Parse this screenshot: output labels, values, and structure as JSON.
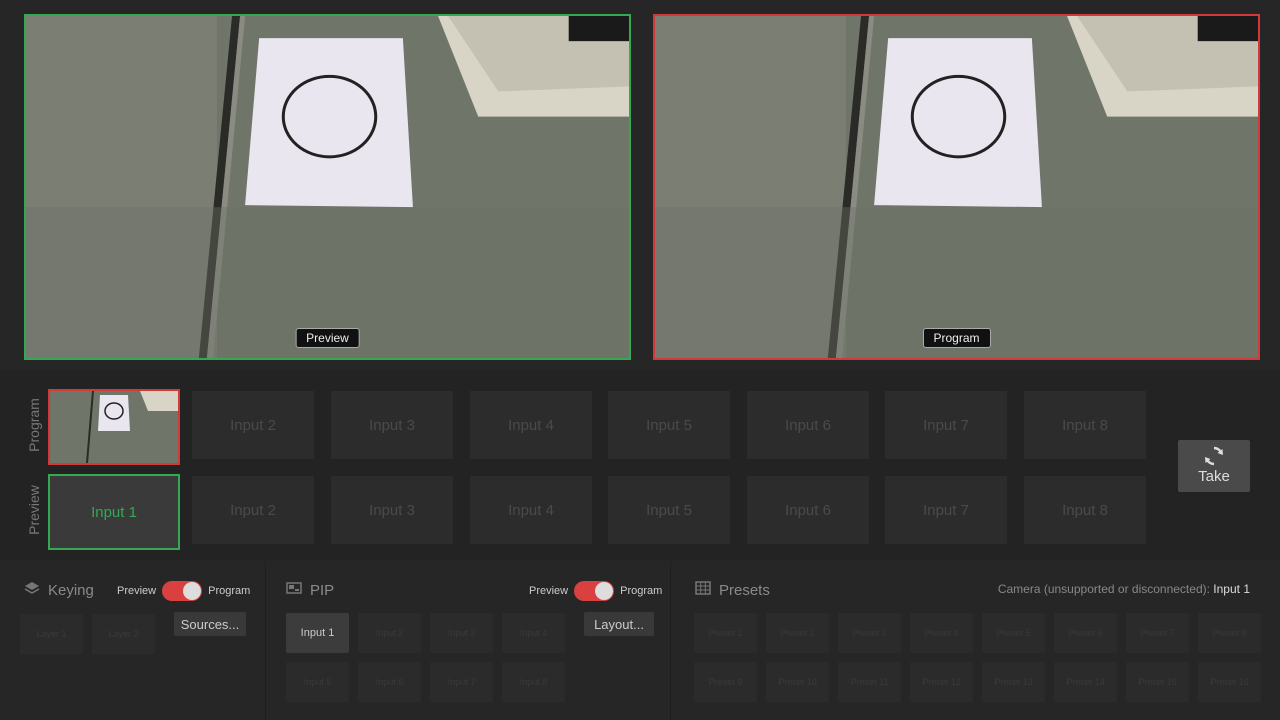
{
  "monitors": {
    "preview_label": "Preview",
    "program_label": "Program"
  },
  "switcher": {
    "program_row_label": "Program",
    "preview_row_label": "Preview",
    "program_inputs": [
      "",
      "Input 2",
      "Input 3",
      "Input 4",
      "Input 5",
      "Input 6",
      "Input 7",
      "Input 8"
    ],
    "preview_inputs": [
      "Input 1",
      "Input 2",
      "Input 3",
      "Input 4",
      "Input 5",
      "Input 6",
      "Input 7",
      "Input 8"
    ],
    "take_label": "Take"
  },
  "keying": {
    "title": "Keying",
    "toggle_left": "Preview",
    "toggle_right": "Program",
    "layers": [
      "Layer 1",
      "Layer 2"
    ],
    "sources_button": "Sources..."
  },
  "pip": {
    "title": "PIP",
    "toggle_left": "Preview",
    "toggle_right": "Program",
    "inputs": [
      "Input 1",
      "Input 2",
      "Input 3",
      "Input 4",
      "Input 5",
      "Input 6",
      "Input 7",
      "Input 8"
    ],
    "layout_button": "Layout..."
  },
  "presets": {
    "title": "Presets",
    "camera_label": "Camera (unsupported or disconnected):",
    "camera_value": "Input 1",
    "items": [
      "Preset 1",
      "Preset 2",
      "Preset 3",
      "Preset 4",
      "Preset 5",
      "Preset 6",
      "Preset 7",
      "Preset 8",
      "Preset 9",
      "Preset 10",
      "Preset 11",
      "Preset 12",
      "Preset 13",
      "Preset 14",
      "Preset 15",
      "Preset 16"
    ]
  },
  "colors": {
    "preview_accent": "#34a853",
    "program_accent": "#d23a3a",
    "toggle_on": "#d94141"
  }
}
